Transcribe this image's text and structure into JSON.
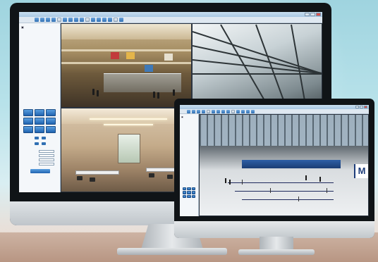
{
  "big_app": {
    "toolbar_icons": [
      "view-1-icon",
      "view-4-icon",
      "view-9-icon",
      "record-icon",
      "snapshot-icon",
      "playback-icon",
      "settings-icon",
      "user-icon",
      "log-icon",
      "alarm-icon",
      "map-icon",
      "layout-icon",
      "fullscreen-icon",
      "ptz-icon",
      "audio-icon",
      "lock-icon"
    ]
  },
  "small_app": {
    "toolbar_icons": [
      "view-1-icon",
      "view-4-icon",
      "view-9-icon",
      "record-icon",
      "snapshot-icon",
      "playback-icon",
      "settings-icon",
      "user-icon",
      "log-icon",
      "alarm-icon",
      "map-icon",
      "layout-icon",
      "fullscreen-icon",
      "ptz-icon"
    ],
    "airport_sign": "M"
  },
  "colors": {
    "accent": "#2f6fb3",
    "titlebar": "#a9c7e2",
    "close": "#d9534f"
  }
}
